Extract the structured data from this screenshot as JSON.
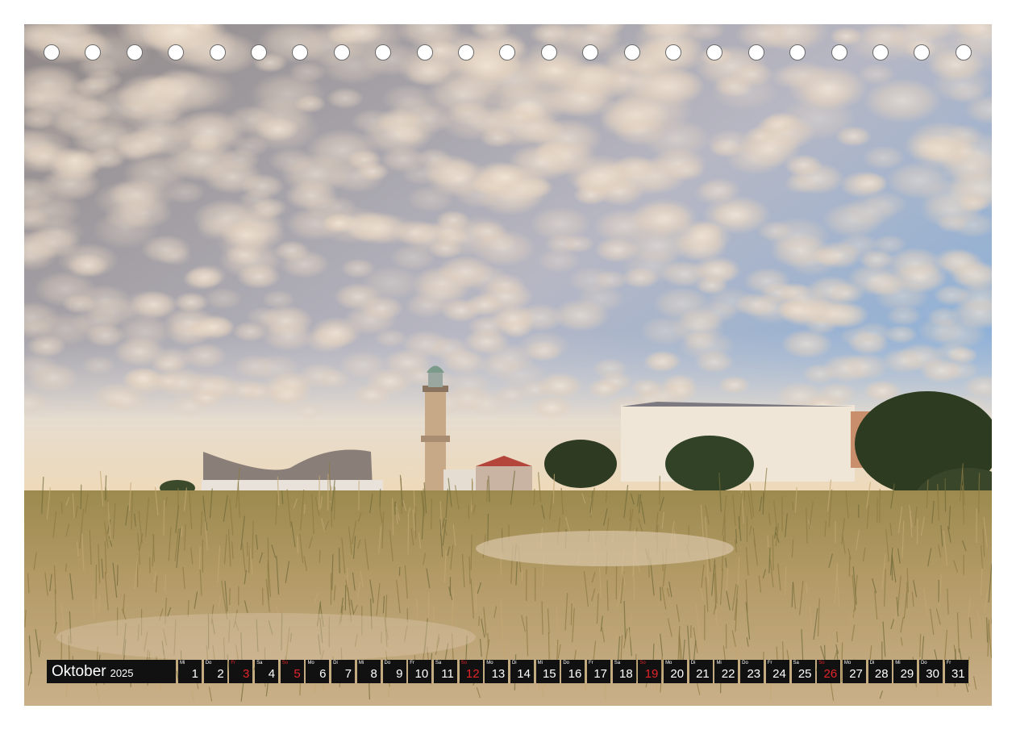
{
  "calendar": {
    "month": "Oktober",
    "year": "2025",
    "days": [
      {
        "wd": "Mi",
        "n": "1",
        "red": false
      },
      {
        "wd": "Do",
        "n": "2",
        "red": false
      },
      {
        "wd": "Fr",
        "n": "3",
        "red": true
      },
      {
        "wd": "Sa",
        "n": "4",
        "red": false
      },
      {
        "wd": "So",
        "n": "5",
        "red": true
      },
      {
        "wd": "Mo",
        "n": "6",
        "red": false
      },
      {
        "wd": "Di",
        "n": "7",
        "red": false
      },
      {
        "wd": "Mi",
        "n": "8",
        "red": false
      },
      {
        "wd": "Do",
        "n": "9",
        "red": false
      },
      {
        "wd": "Fr",
        "n": "10",
        "red": false
      },
      {
        "wd": "Sa",
        "n": "11",
        "red": false
      },
      {
        "wd": "So",
        "n": "12",
        "red": true
      },
      {
        "wd": "Mo",
        "n": "13",
        "red": false
      },
      {
        "wd": "Di",
        "n": "14",
        "red": false
      },
      {
        "wd": "Mi",
        "n": "15",
        "red": false
      },
      {
        "wd": "Do",
        "n": "16",
        "red": false
      },
      {
        "wd": "Fr",
        "n": "17",
        "red": false
      },
      {
        "wd": "Sa",
        "n": "18",
        "red": false
      },
      {
        "wd": "So",
        "n": "19",
        "red": true
      },
      {
        "wd": "Mo",
        "n": "20",
        "red": false
      },
      {
        "wd": "Di",
        "n": "21",
        "red": false
      },
      {
        "wd": "Mi",
        "n": "22",
        "red": false
      },
      {
        "wd": "Do",
        "n": "23",
        "red": false
      },
      {
        "wd": "Fr",
        "n": "24",
        "red": false
      },
      {
        "wd": "Sa",
        "n": "25",
        "red": false
      },
      {
        "wd": "So",
        "n": "26",
        "red": true
      },
      {
        "wd": "Mo",
        "n": "27",
        "red": false
      },
      {
        "wd": "Di",
        "n": "28",
        "red": false
      },
      {
        "wd": "Mi",
        "n": "29",
        "red": false
      },
      {
        "wd": "Do",
        "n": "30",
        "red": false
      },
      {
        "wd": "Fr",
        "n": "31",
        "red": false
      }
    ]
  },
  "binding_hole_count": 23,
  "colors": {
    "sky_blue": "#7fa9d6",
    "cloud": "#e9ddcd",
    "cloud_shade": "#9a8d86",
    "grass": "#a58a55",
    "sand": "#d8c4a6",
    "highlight": "#e3242b",
    "bar": "#111111"
  }
}
